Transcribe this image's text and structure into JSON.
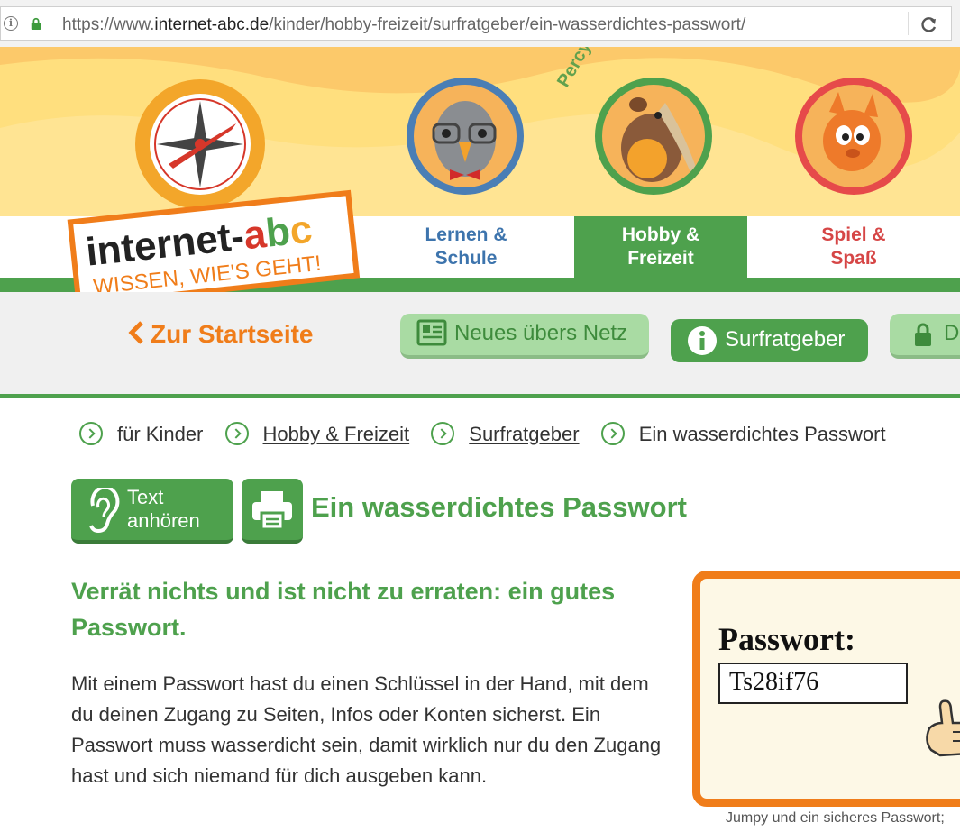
{
  "browser": {
    "url_prefix": "https://www.",
    "url_domain": "internet-abc.de",
    "url_path": "/kinder/hobby-freizeit/surfratgeber/ein-wasserdichtes-passwort/"
  },
  "header": {
    "logo_text": "internet-abc",
    "logo_tagline": "WISSEN, WIE'S GEHT!",
    "character_label": "Percy",
    "tabs": [
      {
        "label_line1": "Lernen &",
        "label_line2": "Schule"
      },
      {
        "label_line1": "Hobby &",
        "label_line2": "Freizeit"
      },
      {
        "label_line1": "Spiel &",
        "label_line2": "Spaß"
      }
    ]
  },
  "subnav": {
    "back_label": "Zur Startseite",
    "pills": [
      {
        "label": "Neues übers Netz"
      },
      {
        "label": "Surfratgeber"
      },
      {
        "label": "D"
      }
    ]
  },
  "breadcrumbs": [
    "für Kinder",
    "Hobby & Freizeit",
    "Surfratgeber",
    "Ein wasserdichtes Passwort"
  ],
  "article": {
    "listen_label_line1": "Text",
    "listen_label_line2": "anhören",
    "title": "Ein wasserdichtes Passwort",
    "subtitle": "Verrät nichts und ist nicht zu erraten: ein gutes Passwort.",
    "body": "Mit einem Passwort hast du einen Schlüssel in der Hand, mit dem du deinen Zugang zu Seiten, Infos oder Konten sicherst. Ein Passwort muss wasserdicht sein, damit wirklich nur du den Zugang hast und sich niemand für dich ausgeben kann.",
    "image_label": "Passwort:",
    "image_password": "Ts28if76",
    "image_caption": "Jumpy und ein sicheres Passwort;"
  },
  "colors": {
    "green": "#4ea14d",
    "orange": "#f07d1a",
    "blue": "#3d74ad",
    "red": "#d64646",
    "yellow": "#ffdf7e"
  }
}
